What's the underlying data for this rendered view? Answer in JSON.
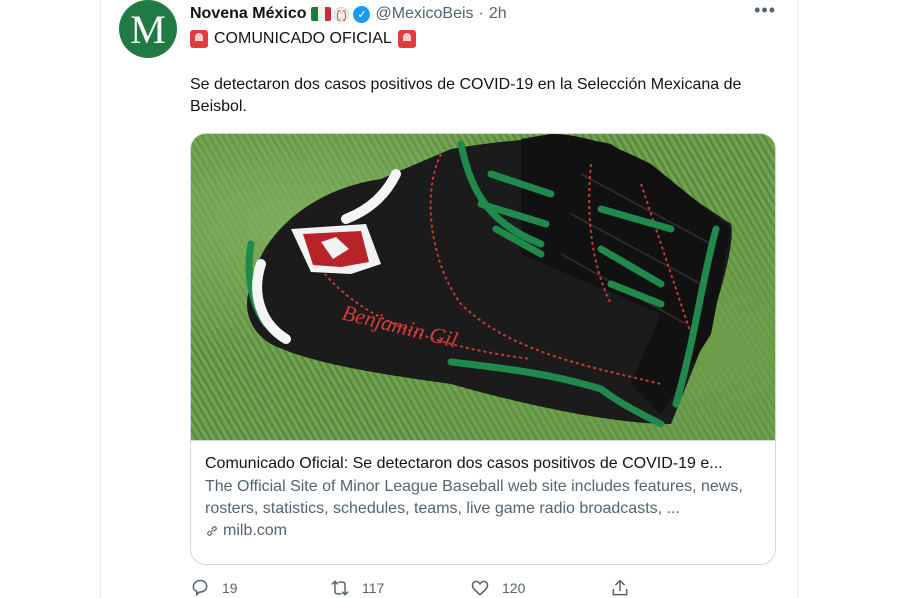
{
  "tweet": {
    "author_name": "Novena México",
    "avatar_letter": "M",
    "handle": "@MexicoBeis",
    "separator": "·",
    "time": "2h",
    "more_label": "•••",
    "subline_text": "COMUNICADO OFICIAL",
    "text": "Se detectaron dos casos positivos de COVID-19 en la Selección Mexicana de Beisbol.",
    "glove_embroidery": "Benjamin Gil"
  },
  "card": {
    "title": "Comunicado Oficial: Se detectaron dos casos positivos de COVID-19 e...",
    "description": "The Official Site of Minor League Baseball web site includes features, news, rosters, statistics, schedules, teams, live game radio broadcasts, ...",
    "domain": "milb.com"
  },
  "actions": {
    "replies": "19",
    "retweets": "117",
    "likes": "120"
  },
  "icons": {
    "verified": "verified-badge-icon",
    "reply": "reply-icon",
    "retweet": "retweet-icon",
    "like": "like-icon",
    "share": "share-icon",
    "link": "link-icon",
    "siren": "siren-icon"
  },
  "colors": {
    "avatar_bg": "#1f7a44",
    "verified": "#1d9bf0",
    "secondary_text": "#536471"
  }
}
